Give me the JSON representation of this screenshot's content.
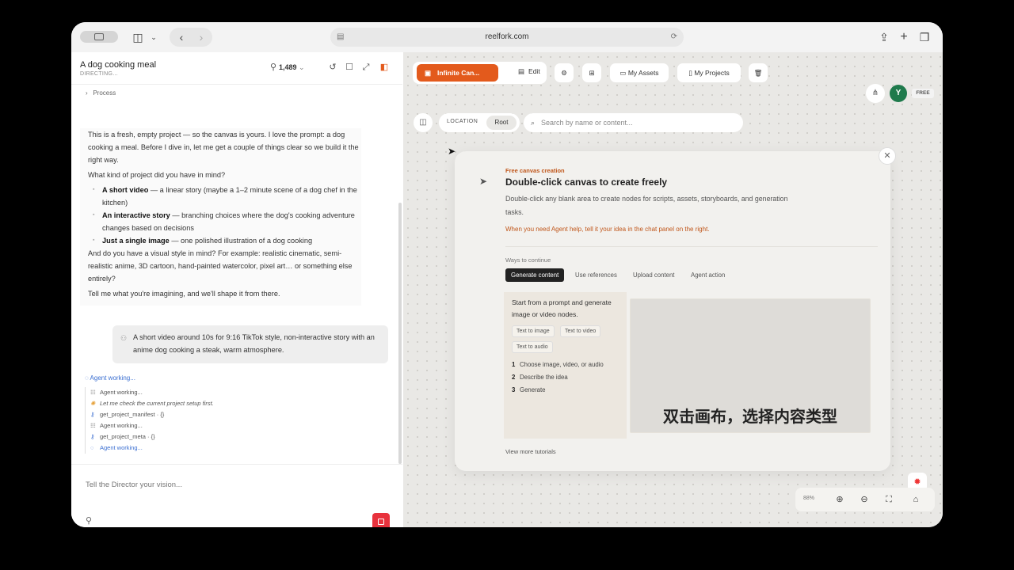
{
  "browser": {
    "url": "reelfork.com"
  },
  "project": {
    "title": "A dog cooking meal",
    "status": "DIRECTING...",
    "credits": "1,489"
  },
  "chat": {
    "process_label": "Process",
    "intro": "This is a fresh, empty project — so the canvas is yours. I love the prompt: a dog cooking a meal. Before I dive in, let me get a couple of things clear so we build it the right way.",
    "question": "What kind of project did you have in mind?",
    "options": [
      {
        "bold": "A short video",
        "text": " — a linear story (maybe a 1–2 minute scene of a dog chef in the kitchen)"
      },
      {
        "bold": "An interactive story",
        "text": " — branching choices where the dog's cooking adventure changes based on decisions"
      },
      {
        "bold": "Just a single image",
        "text": " — one polished illustration of a dog cooking"
      }
    ],
    "style_q": "And do you have a visual style in mind? For example: realistic cinematic, semi-realistic anime, 3D cartoon, hand-painted watercolor, pixel art… or something else entirely?",
    "outro": "Tell me what you're imagining, and we'll shape it from there.",
    "user_message": "A short video around 10s for 9:16 TikTok style, non-interactive story with an anime dog cooking a steak, warm atmosphere.",
    "agent_status": "Agent working...",
    "tools": [
      {
        "icon": "☷",
        "text": "Agent working...",
        "style": ""
      },
      {
        "icon": "✺",
        "text": "Let me check the current project setup first.",
        "style": "it"
      },
      {
        "icon": "⚷",
        "text": "get_project_manifest · {}",
        "style": ""
      },
      {
        "icon": "☷",
        "text": "Agent working...",
        "style": ""
      },
      {
        "icon": "⚷",
        "text": "get_project_meta · {}",
        "style": ""
      },
      {
        "icon": "◌",
        "text": "Agent working...",
        "style": "bl"
      }
    ],
    "input_placeholder": "Tell the Director your vision..."
  },
  "toolbar": {
    "infinite_canvas": "Infinite Can...",
    "edit": "Edit",
    "my_assets": "My Assets",
    "my_projects": "My Projects",
    "location": "LOCATION",
    "root": "Root",
    "search_placeholder": "Search by name or content...",
    "avatar_initial": "Y",
    "plan": "FREE"
  },
  "card": {
    "kicker": "Free canvas creation",
    "title": "Double-click canvas to create freely",
    "desc": "Double-click any blank area to create nodes for scripts, assets, storyboards, and generation tasks.",
    "note": "When you need Agent help, tell it your idea in the chat panel on the right.",
    "ways": "Ways to continue",
    "tabs": [
      "Generate content",
      "Use references",
      "Upload content",
      "Agent action"
    ],
    "panel_text": "Start from a prompt and generate image or video nodes.",
    "chips": [
      "Text to image",
      "Text to video",
      "Text to audio"
    ],
    "steps": [
      "Choose image, video, or audio",
      "Describe the idea",
      "Generate"
    ],
    "preview_caption": "双击画布，选择内容类型",
    "more": "View more tutorials"
  },
  "zoom": {
    "level": "88%"
  },
  "colors": {
    "accent": "#e35a1c",
    "stop": "#e8323d",
    "avatar": "#1f7a4c",
    "link": "#3b6fd1"
  }
}
